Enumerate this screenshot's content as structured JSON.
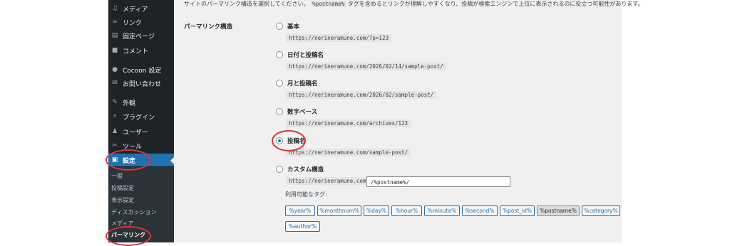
{
  "sidebar": {
    "items": [
      {
        "label": "メディア",
        "icon": "media-icon"
      },
      {
        "label": "リンク",
        "icon": "link-icon"
      },
      {
        "label": "固定ページ",
        "icon": "pages-icon"
      },
      {
        "label": "コメント",
        "icon": "comment-icon"
      },
      {
        "label": "Cocoon 設定",
        "icon": "cocoon-icon"
      },
      {
        "label": "お問い合わせ",
        "icon": "mail-icon"
      },
      {
        "label": "外観",
        "icon": "appearance-icon"
      },
      {
        "label": "プラグイン",
        "icon": "plugin-icon"
      },
      {
        "label": "ユーザー",
        "icon": "user-icon"
      },
      {
        "label": "ツール",
        "icon": "tools-icon"
      },
      {
        "label": "設定",
        "icon": "settings-icon"
      }
    ],
    "submenu": [
      "一般",
      "投稿設定",
      "表示設定",
      "ディスカッション",
      "メディア",
      "パーマリンク"
    ]
  },
  "main": {
    "description_prefix": "サイトのパーマリンク構造を選択してください。",
    "description_code": "%postname%",
    "description_suffix": "タグを含めるとリンクが理解しやすくなり、投稿が検索エンジンで上位に表示されるのに役立つ可能性があります。",
    "section_label": "パーマリンク構造",
    "options": [
      {
        "label": "基本",
        "example": "https://nerineramune.com/?p=123",
        "checked": false
      },
      {
        "label": "日付と投稿名",
        "example": "https://nerineramune.com/2026/02/14/sample-post/",
        "checked": false
      },
      {
        "label": "月と投稿名",
        "example": "https://nerineramune.com/2026/02/sample-post/",
        "checked": false
      },
      {
        "label": "数字ベース",
        "example": "https://nerineramune.com/archives/123",
        "checked": false
      },
      {
        "label": "投稿名",
        "example": "https://nerineramune.com/sample-post/",
        "checked": true
      },
      {
        "label": "カスタム構造",
        "example": "https://nerineramune.com",
        "checked": false
      }
    ],
    "custom_value": "/%postname%/",
    "available_tags_label": "利用可能なタグ:",
    "tags": [
      "%year%",
      "%monthnum%",
      "%day%",
      "%hour%",
      "%minute%",
      "%second%",
      "%post_id%",
      "%postname%",
      "%category%",
      "%author%"
    ],
    "selected_tag": "%postname%"
  },
  "colors": {
    "accent": "#2271b1",
    "highlight": "#d63638",
    "sidebar": "#1d2327"
  }
}
